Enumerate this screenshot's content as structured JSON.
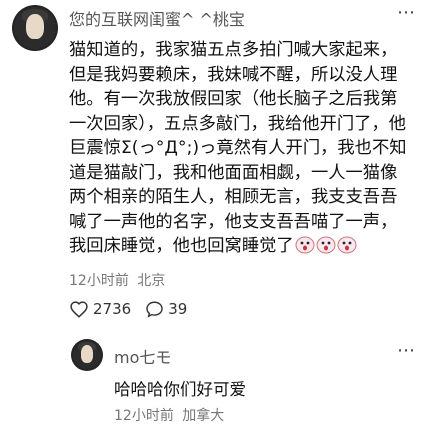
{
  "post": {
    "username": "您的互联网闺蜜^ ^桃宝",
    "content": "猫知道的，我家猫五点多拍门喊大家起来，但是我妈要赖床，我妹喊不醒，所以没人理他。有一次我放假回家（他长脑子之后我第一次回家），五点多敲门，我给他开门了，他巨震惊Σ(っ°Д°;)っ竟然有人开门，我也不知道是猫敲门，我和他面面相觑，一人一猫像两个相亲的陌生人，相顾无言，我支支吾吾喊了一声他的名字，他支支吾吾喵了一声，我回床睡觉，他也回窝睡觉了",
    "emoji_icons": [
      "shocked-face-icon",
      "shocked-face-icon",
      "shocked-face-icon"
    ],
    "time": "12小时前",
    "location": "北京",
    "likes": "2736",
    "comments": "39"
  },
  "reply": {
    "username": "mo七モ",
    "content": "哈哈哈你们好可爱",
    "time": "12小时前",
    "location": "加拿大"
  },
  "colors": {
    "text": "#111111",
    "meta": "#777777",
    "username": "#555555"
  }
}
